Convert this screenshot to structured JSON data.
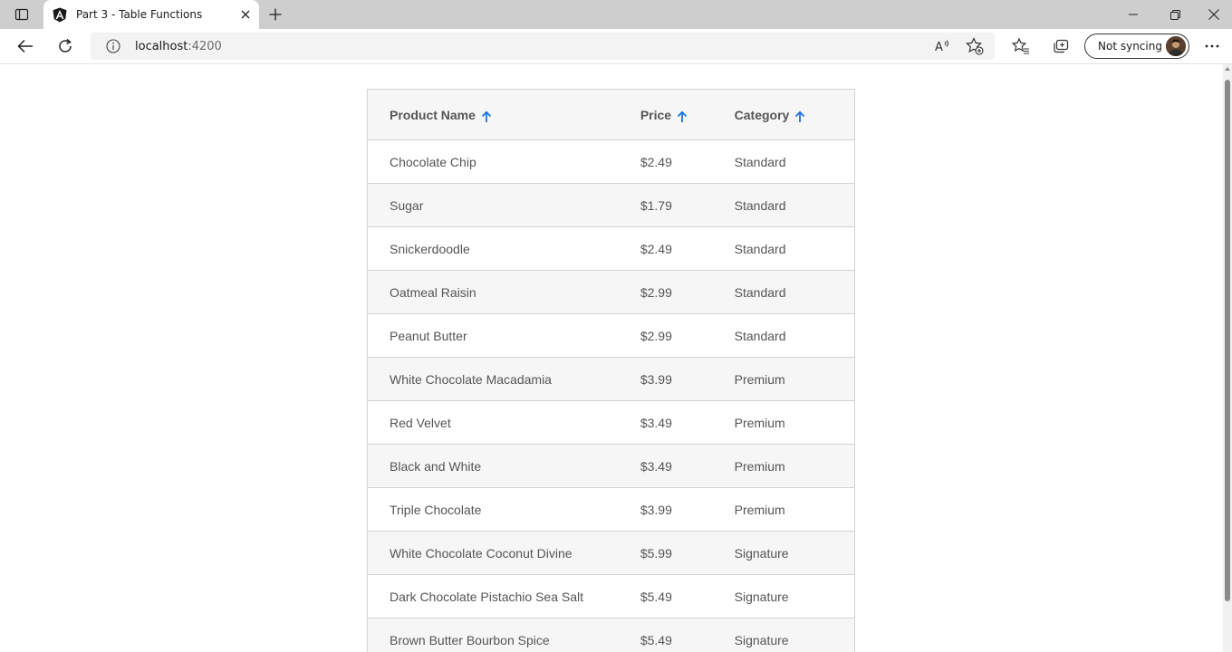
{
  "browser": {
    "tab_title": "Part 3 - Table Functions",
    "url_host": "localhost",
    "url_port": ":4200",
    "sync_label": "Not syncing",
    "icons": {
      "tab_actions": "tab-actions-icon",
      "favicon": "angular-icon",
      "tab_close": "close-icon",
      "new_tab": "plus-icon",
      "minimize": "minimize-icon",
      "restore": "restore-icon",
      "close_window": "close-icon",
      "back": "back-arrow-icon",
      "refresh": "refresh-icon",
      "site_info": "info-icon",
      "read_aloud": "read-aloud-icon",
      "add_favorite": "add-favorite-icon",
      "favorites": "favorites-icon",
      "collections": "collections-icon",
      "more": "more-icon"
    }
  },
  "table": {
    "accent_color": "#1a73e8",
    "headers": {
      "name": "Product Name",
      "price": "Price",
      "category": "Category"
    },
    "rows": [
      {
        "name": "Chocolate Chip",
        "price": "$2.49",
        "category": "Standard"
      },
      {
        "name": "Sugar",
        "price": "$1.79",
        "category": "Standard"
      },
      {
        "name": "Snickerdoodle",
        "price": "$2.49",
        "category": "Standard"
      },
      {
        "name": "Oatmeal Raisin",
        "price": "$2.99",
        "category": "Standard"
      },
      {
        "name": "Peanut Butter",
        "price": "$2.99",
        "category": "Standard"
      },
      {
        "name": "White Chocolate Macadamia",
        "price": "$3.99",
        "category": "Premium"
      },
      {
        "name": "Red Velvet",
        "price": "$3.49",
        "category": "Premium"
      },
      {
        "name": "Black and White",
        "price": "$3.49",
        "category": "Premium"
      },
      {
        "name": "Triple Chocolate",
        "price": "$3.99",
        "category": "Premium"
      },
      {
        "name": "White Chocolate Coconut Divine",
        "price": "$5.99",
        "category": "Signature"
      },
      {
        "name": "Dark Chocolate Pistachio Sea Salt",
        "price": "$5.49",
        "category": "Signature"
      },
      {
        "name": "Brown Butter Bourbon Spice",
        "price": "$5.49",
        "category": "Signature"
      }
    ]
  }
}
